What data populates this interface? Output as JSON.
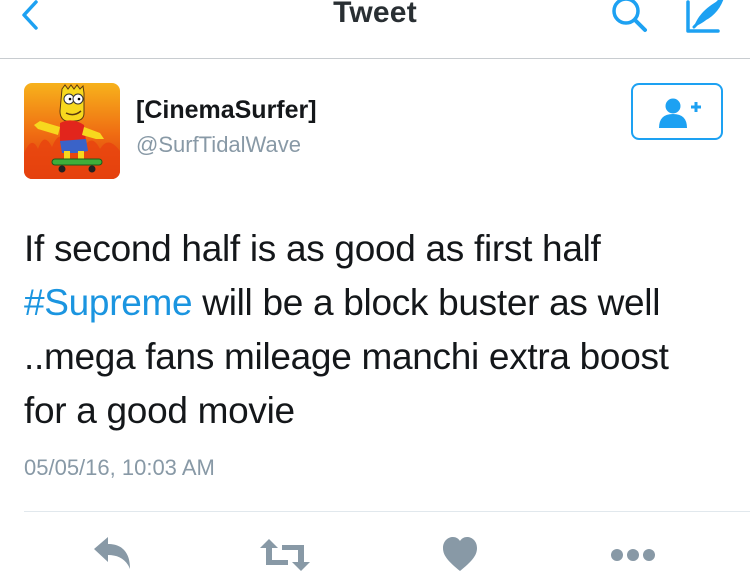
{
  "nav": {
    "title": "Tweet",
    "icons": [
      "chevron-left-icon",
      "search-icon",
      "compose-icon"
    ]
  },
  "author": {
    "name": "[CinemaSurfer]",
    "handle": "@SurfTidalWave",
    "avatar": "bart-skateboard-avatar"
  },
  "tweet": {
    "text_before": "If second half is as good as first half ",
    "hashtag": "#Supreme",
    "text_after": " will be a block buster as well ..mega fans mileage manchi extra boost for a good movie",
    "timestamp": "05/05/16, 10:03 AM"
  },
  "actions": [
    "reply-icon",
    "retweet-icon",
    "heart-icon",
    "more-icon"
  ],
  "colors": {
    "accent": "#1da1f2",
    "hashtag": "#1b95e0",
    "icon_gray": "#8899a6",
    "text": "#14171a"
  }
}
